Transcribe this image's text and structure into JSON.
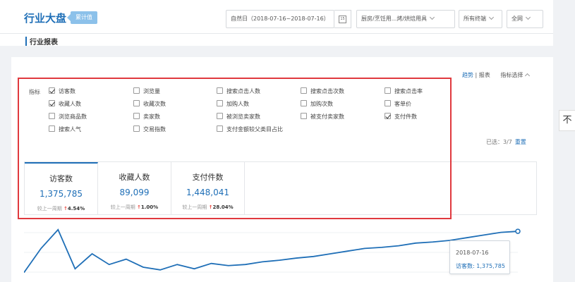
{
  "header": {
    "brand": "行业大盘",
    "badge": "累计值",
    "date_range": "自然日（2018-07-16~2018-07-16）",
    "calendar_icon_text": "15",
    "category": "厨房/烹饪用...烤/烘焙用具",
    "terminal": "所有终端",
    "network": "全网"
  },
  "section_title": "行业报表",
  "top_links": {
    "trend": "趋势",
    "separator": "|",
    "report": "报表",
    "metric_select": "指标选择"
  },
  "metrics_label": "指标",
  "options": [
    {
      "label": "访客数",
      "checked": true
    },
    {
      "label": "浏览量",
      "checked": false
    },
    {
      "label": "搜索点击人数",
      "checked": false
    },
    {
      "label": "搜索点击次数",
      "checked": false
    },
    {
      "label": "搜索点击率",
      "checked": false
    },
    {
      "label": "收藏人数",
      "checked": true
    },
    {
      "label": "收藏次数",
      "checked": false
    },
    {
      "label": "加购人数",
      "checked": false
    },
    {
      "label": "加购次数",
      "checked": false
    },
    {
      "label": "客单价",
      "checked": false
    },
    {
      "label": "浏览商品数",
      "checked": false
    },
    {
      "label": "卖家数",
      "checked": false
    },
    {
      "label": "被浏览卖家数",
      "checked": false
    },
    {
      "label": "被支付卖家数",
      "checked": false
    },
    {
      "label": "支付件数",
      "checked": true
    },
    {
      "label": "搜索人气",
      "checked": false
    },
    {
      "label": "交易指数",
      "checked": false
    },
    {
      "label": "支付金额较父类目占比",
      "checked": false
    }
  ],
  "selected_info": {
    "text": "已选：3/7",
    "reset": "重置"
  },
  "tabs": [
    {
      "title": "访客数",
      "value": "1,375,785",
      "compare_label": "较上一周期",
      "arrow": "↑",
      "change": "4.54%"
    },
    {
      "title": "收藏人数",
      "value": "89,099",
      "compare_label": "较上一周期",
      "arrow": "↑",
      "change": "1.00%"
    },
    {
      "title": "支付件数",
      "value": "1,448,041",
      "compare_label": "较上一周期",
      "arrow": "↑",
      "change": "28.04%"
    }
  ],
  "side_tab": "不",
  "tooltip": {
    "date": "2018-07-16",
    "series": "访客数: 1,375,785"
  },
  "colors": {
    "accent": "#1f6fb7",
    "highlight_frame": "#e0393e",
    "up": "#e8453c"
  },
  "chart_data": {
    "type": "line",
    "series": [
      {
        "name": "访客数",
        "values": [
          0.15,
          0.6,
          0.95,
          0.22,
          0.5,
          0.3,
          0.4,
          0.25,
          0.2,
          0.3,
          0.22,
          0.32,
          0.28,
          0.3,
          0.35,
          0.38,
          0.42,
          0.45,
          0.5,
          0.55,
          0.6,
          0.62,
          0.65,
          0.7,
          0.72,
          0.75,
          0.8,
          0.85,
          0.9,
          0.92
        ]
      }
    ]
  }
}
